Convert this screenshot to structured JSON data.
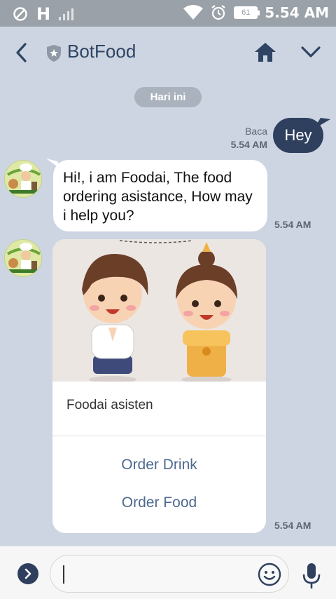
{
  "status_bar": {
    "network": "H",
    "battery": "61",
    "time": "5.54 AM"
  },
  "header": {
    "title": "BotFood"
  },
  "chat": {
    "date_label": "Hari ini",
    "messages": [
      {
        "from": "me",
        "text": "Hey",
        "read_label": "Baca",
        "time": "5.54 AM"
      },
      {
        "from": "bot",
        "text": "Hi!, i am Foodai, The food ordering asistance, How may i help you?",
        "time": "5.54 AM"
      }
    ],
    "card": {
      "title": "Foodai asisten",
      "actions": [
        "Order Drink",
        "Order Food"
      ],
      "time": "5.54 AM"
    }
  },
  "input": {
    "placeholder": ""
  },
  "colors": {
    "background": "#ccd5e1",
    "my_bubble": "#2f3f5e",
    "link": "#4f6a8f"
  }
}
